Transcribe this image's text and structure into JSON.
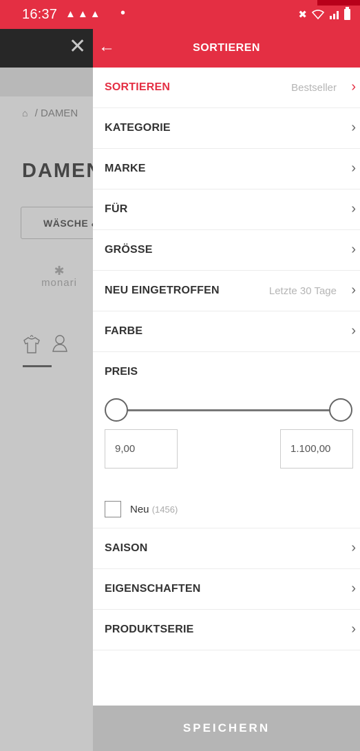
{
  "status_bar": {
    "time": "16:37",
    "notification_icons": [
      "snapchat-icon",
      "snapchat-icon",
      "snapchat-icon"
    ],
    "dot": "•",
    "right_icons": [
      "mute-icon",
      "wifi-icon",
      "signal-icon",
      "battery-icon"
    ]
  },
  "background_page": {
    "close": "✕",
    "breadcrumb": "/ DAMEN",
    "title": "DAMEN",
    "chip_label": "WÄSCHE &",
    "brand_logo": "monari"
  },
  "panel": {
    "title": "SORTIEREN",
    "back": "←",
    "rows_top": [
      {
        "label": "SORTIEREN",
        "value": "Bestseller",
        "active": true
      },
      {
        "label": "KATEGORIE",
        "value": ""
      },
      {
        "label": "MARKE",
        "value": ""
      },
      {
        "label": "FÜR",
        "value": ""
      },
      {
        "label": "GRÖSSE",
        "value": ""
      },
      {
        "label": "NEU EINGETROFFEN",
        "value": "Letzte 30 Tage"
      },
      {
        "label": "FARBE",
        "value": ""
      }
    ],
    "price": {
      "label": "PREIS",
      "min": "9,00",
      "max": "1.100,00"
    },
    "checkbox": {
      "label": "Neu",
      "count": "(1456)",
      "checked": false
    },
    "rows_bottom": [
      {
        "label": "SAISON"
      },
      {
        "label": "EIGENSCHAFTEN"
      },
      {
        "label": "PRODUKTSERIE"
      }
    ],
    "chevron": "›",
    "save_label": "SPEICHERN"
  },
  "colors": {
    "accent": "#e42f43",
    "save_disabled": "#b5b5b5"
  }
}
